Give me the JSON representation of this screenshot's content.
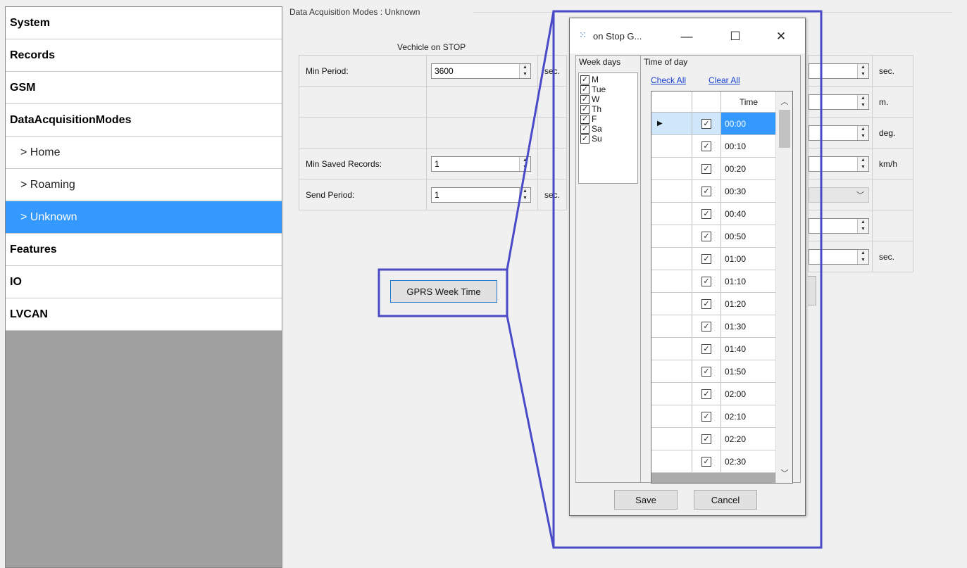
{
  "sidebar": {
    "items": [
      {
        "label": "System"
      },
      {
        "label": "Records"
      },
      {
        "label": "GSM"
      },
      {
        "label": "DataAcquisitionModes"
      },
      {
        "label": "> Home"
      },
      {
        "label": "> Roaming"
      },
      {
        "label": "> Unknown",
        "selected": true
      },
      {
        "label": "Features"
      },
      {
        "label": "IO"
      },
      {
        "label": "LVCAN"
      }
    ]
  },
  "main": {
    "group_title": "Data Acquisition Modes : Unknown",
    "stop_title": "Vechicle on STOP",
    "rows": [
      {
        "label": "Min Period:",
        "value": "3600",
        "unit": "sec."
      },
      {
        "label": "",
        "value": "",
        "unit": ""
      },
      {
        "label": "",
        "value": "",
        "unit": ""
      },
      {
        "label": "Min Saved Records:",
        "value": "1",
        "unit": ""
      },
      {
        "label": "Send Period:",
        "value": "1",
        "unit": "sec."
      }
    ],
    "right_units": [
      "sec.",
      "m.",
      "deg.",
      "km/h",
      "",
      "",
      "sec."
    ],
    "gprs_button": "GPRS Week Time"
  },
  "dialog": {
    "title": "on Stop G...",
    "minimize": "—",
    "maximize": "☐",
    "close": "✕",
    "weekdays_header": "Week days",
    "weekdays": [
      "M",
      "Tue",
      "W",
      "Th",
      "F",
      "Sa",
      "Su"
    ],
    "timeofday_header": "Time of day",
    "check_all": "Check All",
    "clear_all": "Clear All",
    "time_column": "Time",
    "row_marker": "▶",
    "times": [
      "00:00",
      "00:10",
      "00:20",
      "00:30",
      "00:40",
      "00:50",
      "01:00",
      "01:10",
      "01:20",
      "01:30",
      "01:40",
      "01:50",
      "02:00",
      "02:10",
      "02:20",
      "02:30"
    ],
    "save": "Save",
    "cancel": "Cancel"
  },
  "colors": {
    "selection": "#3399ff",
    "callout": "#4a4ac8",
    "link": "#1a3fcf"
  }
}
